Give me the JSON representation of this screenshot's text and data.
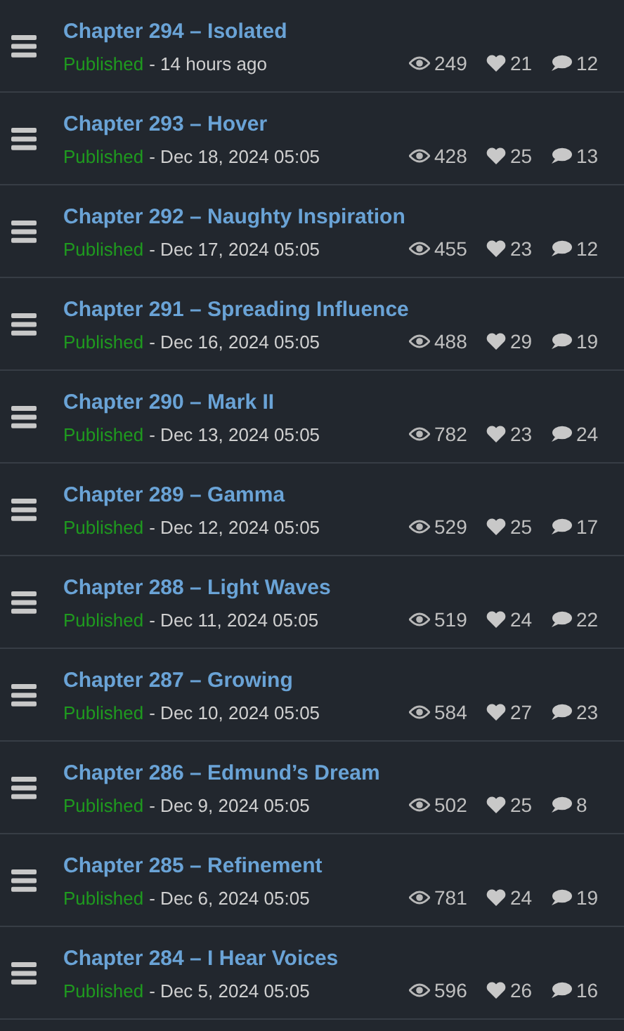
{
  "chapters": [
    {
      "title": "Chapter 294 – Isolated",
      "status": "Published",
      "date": "- 14 hours ago",
      "views": "249",
      "likes": "21",
      "comments": "12"
    },
    {
      "title": "Chapter 293 – Hover",
      "status": "Published",
      "date": "- Dec 18, 2024 05:05",
      "views": "428",
      "likes": "25",
      "comments": "13"
    },
    {
      "title": "Chapter 292 – Naughty Inspiration",
      "status": "Published",
      "date": "- Dec 17, 2024 05:05",
      "views": "455",
      "likes": "23",
      "comments": "12"
    },
    {
      "title": "Chapter 291 – Spreading Influence",
      "status": "Published",
      "date": "- Dec 16, 2024 05:05",
      "views": "488",
      "likes": "29",
      "comments": "19"
    },
    {
      "title": "Chapter 290 – Mark II",
      "status": "Published",
      "date": "- Dec 13, 2024 05:05",
      "views": "782",
      "likes": "23",
      "comments": "24"
    },
    {
      "title": "Chapter 289 – Gamma",
      "status": "Published",
      "date": "- Dec 12, 2024 05:05",
      "views": "529",
      "likes": "25",
      "comments": "17"
    },
    {
      "title": "Chapter 288 – Light Waves",
      "status": "Published",
      "date": "- Dec 11, 2024 05:05",
      "views": "519",
      "likes": "24",
      "comments": "22"
    },
    {
      "title": "Chapter 287 – Growing",
      "status": "Published",
      "date": "- Dec 10, 2024 05:05",
      "views": "584",
      "likes": "27",
      "comments": "23"
    },
    {
      "title": "Chapter 286 – Edmund’s Dream",
      "status": "Published",
      "date": "- Dec 9, 2024 05:05",
      "views": "502",
      "likes": "25",
      "comments": "8"
    },
    {
      "title": "Chapter 285 – Refinement",
      "status": "Published",
      "date": "- Dec 6, 2024 05:05",
      "views": "781",
      "likes": "24",
      "comments": "19"
    },
    {
      "title": "Chapter 284 – I Hear Voices",
      "status": "Published",
      "date": "- Dec 5, 2024 05:05",
      "views": "596",
      "likes": "26",
      "comments": "16"
    }
  ]
}
